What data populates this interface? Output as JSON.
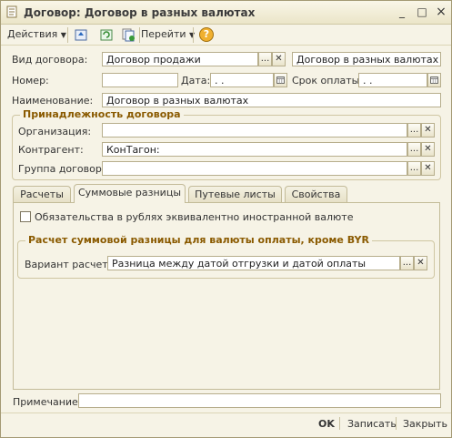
{
  "window": {
    "title": "Договор: Договор  в разных валютах",
    "controls": {
      "minimize": "_",
      "maximize": "□",
      "close": "×"
    }
  },
  "toolbar": {
    "actions_label": "Действия",
    "goto_label": "Перейти",
    "help_label": "?"
  },
  "header": {
    "contract_type_label": "Вид договора:",
    "contract_type_value": "Договор  продажи",
    "contract_name_display": "Договор  в разных валютах",
    "number_label": "Номер:",
    "number_value": "",
    "date_label": "Дата:",
    "date_value": " .  .",
    "payment_term_label": "Срок оплаты:",
    "payment_term_value": " .  .",
    "name_label": "Наименование:",
    "name_value": "Договор в разных валютах"
  },
  "ownership": {
    "title": "Принадлежность договора",
    "organization_label": "Организация:",
    "organization_value": "",
    "counterparty_label": "Контрагент:",
    "counterparty_value": "КонТагон:",
    "group_label": "Группа договора:",
    "group_value": ""
  },
  "tabs": [
    {
      "label": "Расчеты"
    },
    {
      "label": "Суммовые разницы"
    },
    {
      "label": "Путевые листы"
    },
    {
      "label": "Свойства"
    }
  ],
  "sum_diff": {
    "obligations_checkbox_label": "Обязательства в рублях эквивалентно иностранной валюте",
    "obligations_checked": false,
    "group_title": "Расчет суммовой разницы для валюты оплаты, кроме BYR",
    "variant_label": "Вариант расчета:",
    "variant_value": "Разница между датой отгрузки и датой оплаты"
  },
  "footer": {
    "note_label": "Примечание:",
    "note_value": "",
    "ok_label": "OK",
    "save_label": "Записать",
    "close_label": "Закрыть"
  },
  "icons": [
    "document-icon",
    "minimize-icon",
    "maximize-icon",
    "close-icon",
    "dropdown-arrow-icon",
    "go-up-icon",
    "refresh-icon",
    "copy-icon",
    "help-icon",
    "calendar-icon",
    "select-ellipsis-icon",
    "clear-x-icon"
  ],
  "colors": {
    "accent": "#8a5a00",
    "window_bg": "#f6f3e6",
    "border": "#b7ae8c"
  }
}
